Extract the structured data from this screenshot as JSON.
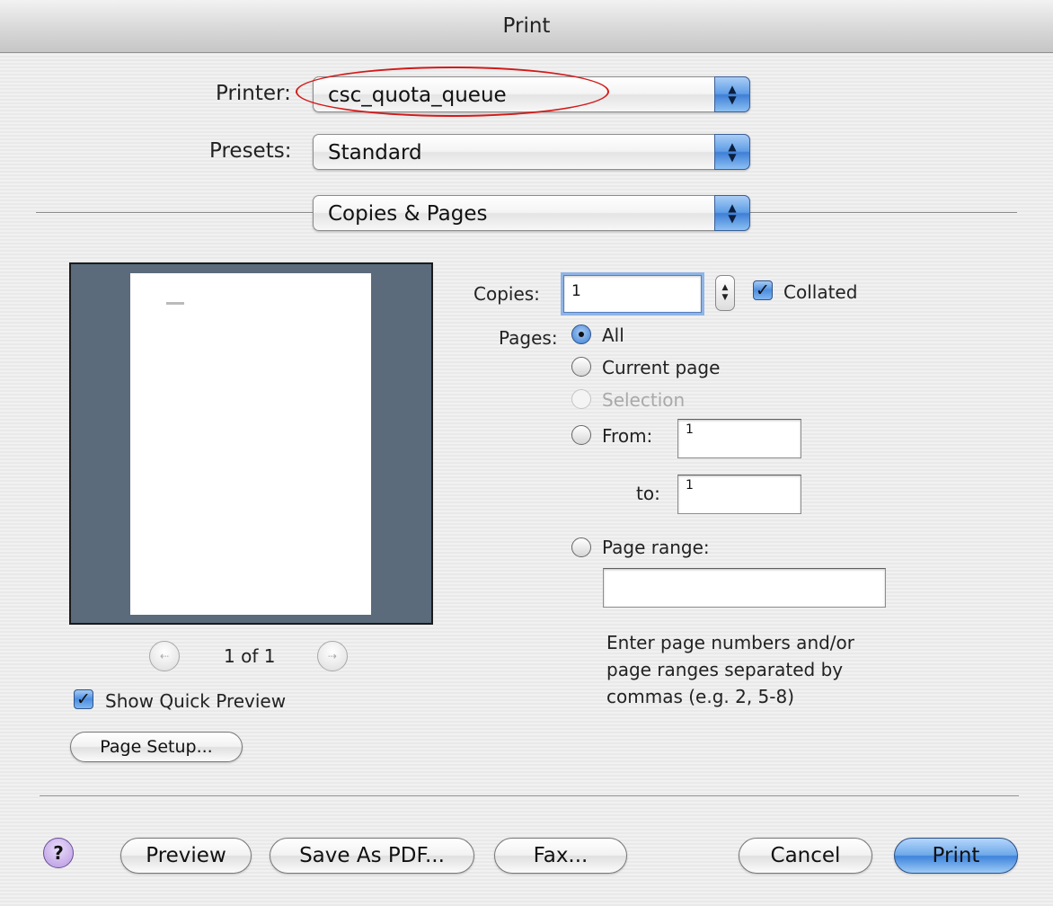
{
  "window": {
    "title": "Print"
  },
  "printer": {
    "label": "Printer:",
    "value": "csc_quota_queue"
  },
  "presets": {
    "label": "Presets:",
    "value": "Standard"
  },
  "panel": {
    "value": "Copies & Pages"
  },
  "preview": {
    "page_indicator": "1 of 1",
    "show_quick_preview_label": "Show Quick Preview",
    "show_quick_preview_checked": true
  },
  "page_setup_label": "Page Setup...",
  "copies": {
    "label": "Copies:",
    "value": "1",
    "collated_label": "Collated",
    "collated_checked": true
  },
  "pages": {
    "label": "Pages:",
    "options": {
      "all": "All",
      "current": "Current page",
      "selection": "Selection",
      "from": "From:",
      "page_range": "Page range:"
    },
    "selected": "All",
    "from_value": "1",
    "to_label": "to:",
    "to_value": "1",
    "range_value": "",
    "help_text_1": "Enter page numbers and/or",
    "help_text_2": "page ranges separated by",
    "help_text_3": "commas (e.g. 2, 5-8)"
  },
  "buttons": {
    "help": "?",
    "preview": "Preview",
    "save_pdf": "Save As PDF...",
    "fax": "Fax...",
    "cancel": "Cancel",
    "print": "Print"
  },
  "icons": {
    "popup_arrows": "updown-arrows-icon",
    "prev_page": "arrow-left-icon",
    "next_page": "arrow-right-icon",
    "checkmark": "checkmark-icon"
  },
  "colors": {
    "annotation": "#d31a1a",
    "accent": "#3f7fd6",
    "preview_bg": "#5b6b7c"
  }
}
